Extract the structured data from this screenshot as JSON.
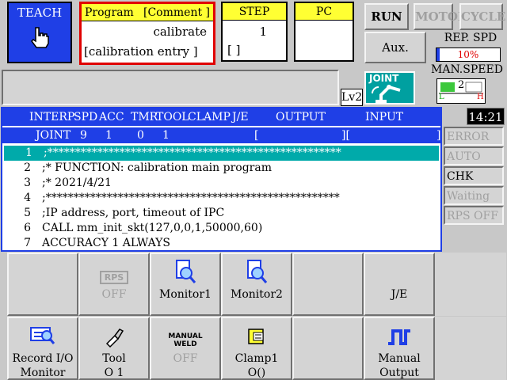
{
  "teach": {
    "label": "TEACH"
  },
  "program": {
    "header_left": "Program",
    "header_right": "[Comment ]",
    "name": "calibrate",
    "comment": "[calibration entry ]"
  },
  "step": {
    "header": "STEP",
    "value": "1",
    "sub": "[        ]"
  },
  "pc": {
    "header": "PC"
  },
  "modes": {
    "run": "RUN",
    "motor": "MOTOR",
    "cycle": "CYCLE"
  },
  "aux": "Aux.",
  "rep_spd": {
    "label": "REP. SPD",
    "value": "10%",
    "level": 0.1
  },
  "man_spd": {
    "label": "MAN.SPEED",
    "value": "2",
    "low": "L",
    "high": "H"
  },
  "level": "Lv2",
  "joint_label": "JOINT",
  "clock": "14:21",
  "table": {
    "headers": [
      "INTERP",
      "SPD",
      "ACC",
      "TMR",
      "TOOL",
      "CLAMP",
      "J/E",
      "OUTPUT",
      "INPUT"
    ],
    "values": [
      "JOINT",
      "9",
      "1",
      "0",
      "1",
      "[",
      "][",
      "]"
    ]
  },
  "lines": [
    {
      "num": "1",
      "code": ";*****************************************************"
    },
    {
      "num": "2",
      "code": ";* FUNCTION: calibration main program"
    },
    {
      "num": "3",
      "code": ";* 2021/4/21"
    },
    {
      "num": "4",
      "code": ";*****************************************************"
    },
    {
      "num": "5",
      "code": ";IP address, port, timeout of IPC"
    },
    {
      "num": "6",
      "code": "CALL mm_init_skt(127,0,0,1,50000,60)"
    },
    {
      "num": "7",
      "code": "ACCURACY 1 ALWAYS"
    }
  ],
  "status": [
    "ERROR",
    "AUTO",
    "CHK once",
    "Waiting",
    "RPS OFF"
  ],
  "buttons_row1": [
    {
      "t1": "",
      "t2": ""
    },
    {
      "t1": "OFF",
      "t2": "",
      "icon_text": "RPS"
    },
    {
      "t1": "Monitor1",
      "t2": ""
    },
    {
      "t1": "Monitor2",
      "t2": ""
    },
    {
      "t1": "",
      "t2": ""
    },
    {
      "t1": "J/E",
      "t2": ""
    },
    {
      "t1": "",
      "t2": ""
    }
  ],
  "buttons_row2": [
    {
      "t1": "Record I/O",
      "t2": "Monitor"
    },
    {
      "t1": "Tool",
      "t2": "O 1"
    },
    {
      "t1": "OFF",
      "t2": "",
      "icon_text_1": "MANUAL",
      "icon_text_2": "WELD"
    },
    {
      "t1": "Clamp1",
      "t2": "O()"
    },
    {
      "t1": "",
      "t2": ""
    },
    {
      "t1": "Manual",
      "t2": "Output"
    },
    {
      "t1": "",
      "t2": ""
    }
  ]
}
